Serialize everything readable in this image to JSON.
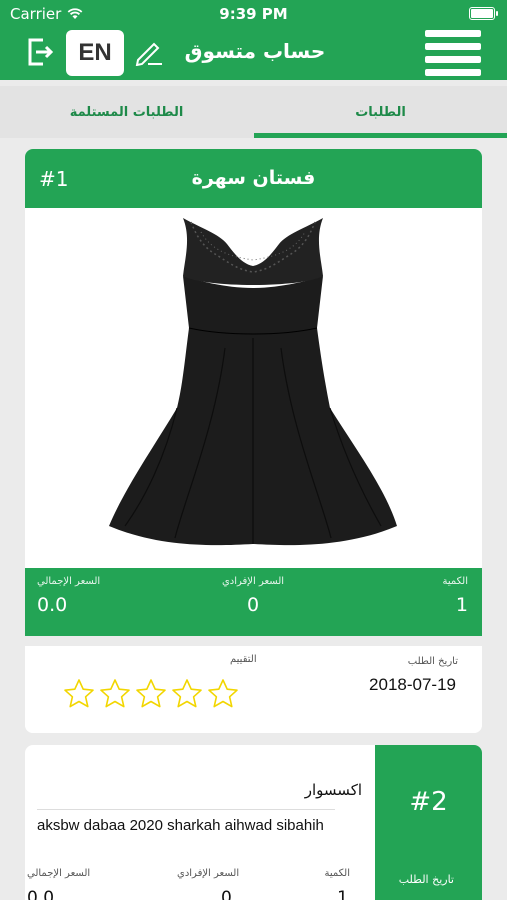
{
  "status_bar": {
    "carrier": "Carrier",
    "time": "9:39 PM"
  },
  "header": {
    "title": "حساب متسوق",
    "lang_button": "EN"
  },
  "tabs": [
    {
      "label": "الطلبات",
      "active": true
    },
    {
      "label": "الطلبات المستلمة",
      "active": false
    }
  ],
  "orders": [
    {
      "number": "#1",
      "product_name": "فستان سهرة",
      "quantity_label": "الكمية",
      "quantity": "1",
      "unit_price_label": "السعر الإفرادي",
      "unit_price": "0",
      "total_price_label": "السعر الإجمالي",
      "total_price": "0.0",
      "date_label": "تاريخ الطلب",
      "date": "2018-07-19",
      "rating_label": "التقييم",
      "rating": 0,
      "rating_max": 5
    },
    {
      "number": "#2",
      "category": "اكسسوار",
      "description": "aksbw dabaa 2020 sharkah aihwad sibahih",
      "quantity_label": "الكمية",
      "quantity": "1",
      "unit_price_label": "السعر الإفرادي",
      "unit_price": "0",
      "total_price_label": "السعر الإجمالي",
      "total_price": "0.0",
      "date_label": "تاريخ الطلب"
    }
  ],
  "colors": {
    "primary": "#23a455",
    "star": "#f2d600"
  },
  "icons": [
    "wifi-icon",
    "battery-icon",
    "logout-icon",
    "edit-icon",
    "menu-icon",
    "star-icon"
  ]
}
